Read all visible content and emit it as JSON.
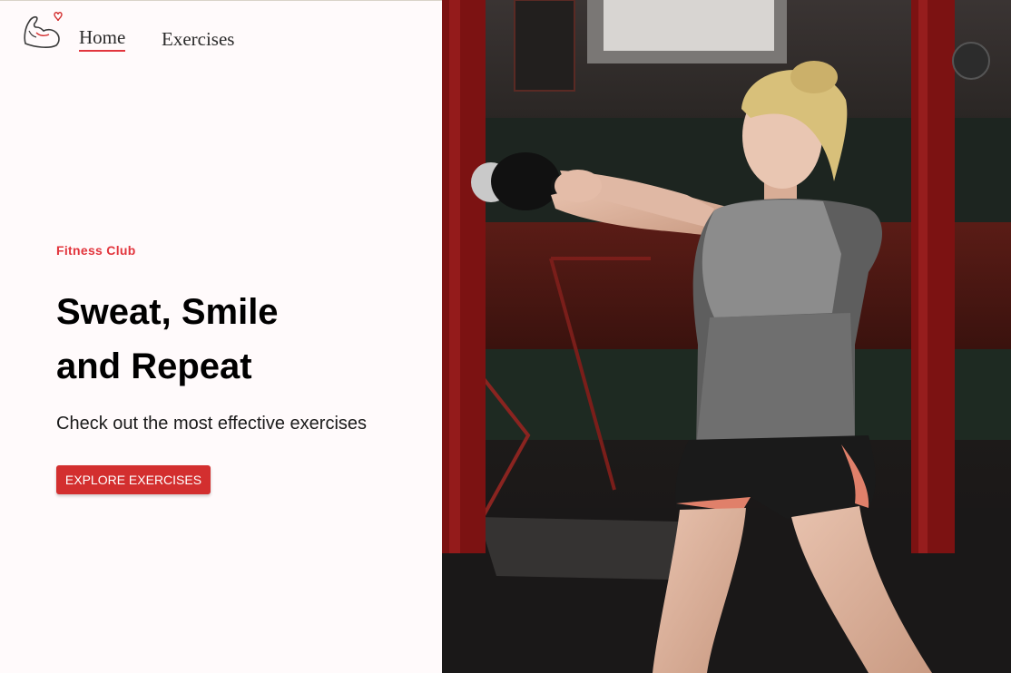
{
  "nav": {
    "logo_icon": "flexed-arm-heart-icon",
    "links": [
      {
        "label": "Home",
        "active": true
      },
      {
        "label": "Exercises",
        "active": false
      }
    ]
  },
  "hero": {
    "eyebrow": "Fitness Club",
    "headline_line1": "Sweat, Smile",
    "headline_line2": "and Repeat",
    "subtitle": "Check out the most effective exercises",
    "cta_label": "EXPLORE EXERCISES",
    "image_icon": "woman-kettlebell-photo"
  },
  "colors": {
    "accent": "#e2353d",
    "button": "#d32f2f",
    "background": "#fffafb"
  }
}
